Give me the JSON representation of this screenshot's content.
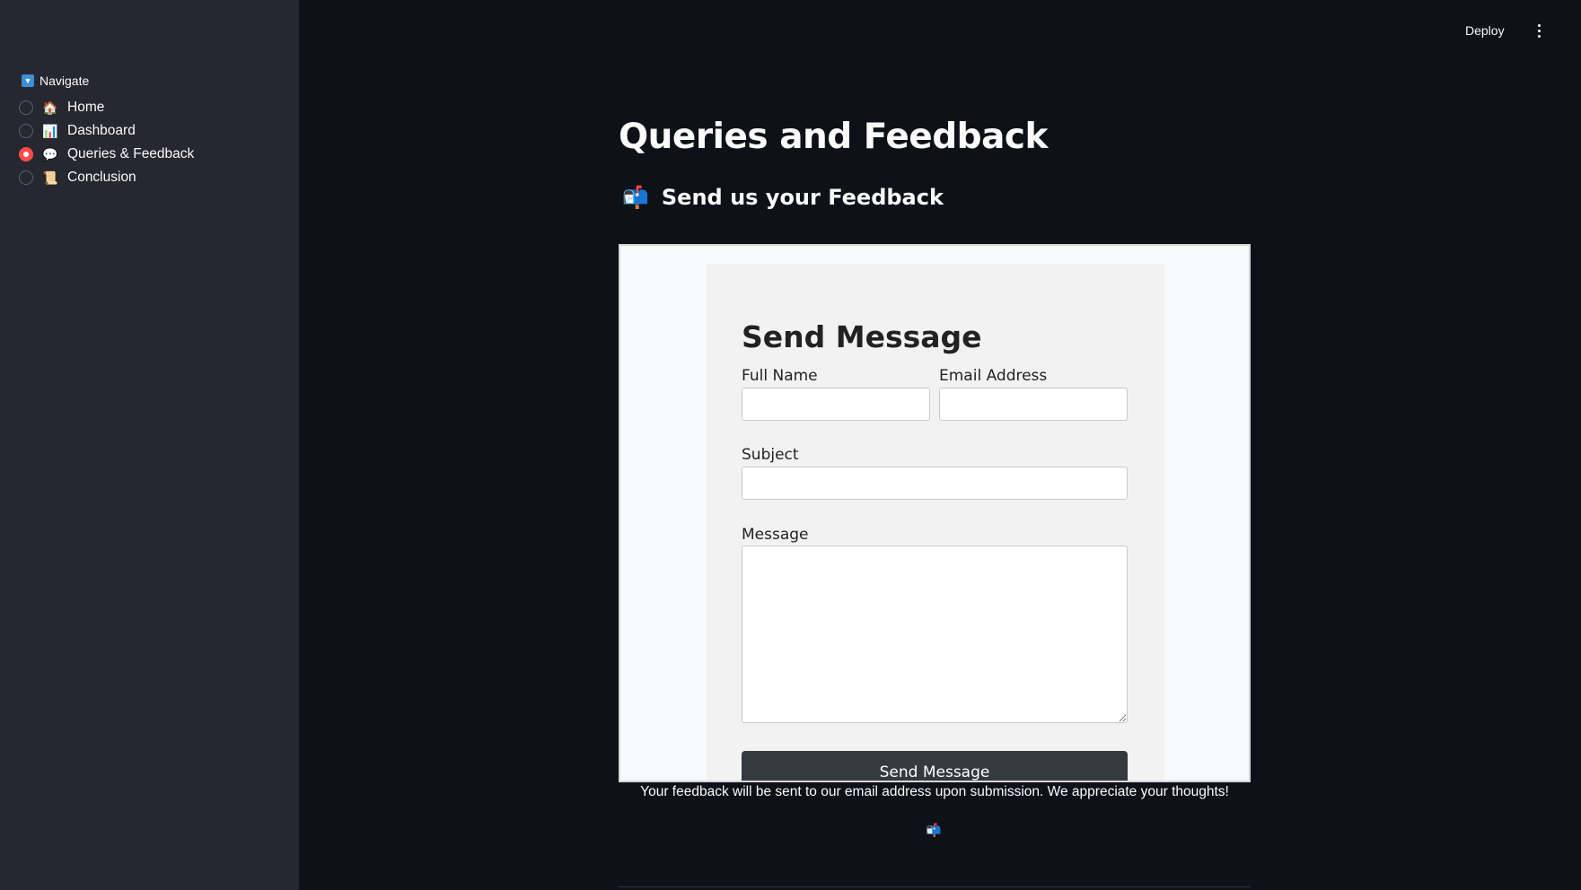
{
  "sidebar": {
    "nav_title": "Navigate",
    "nav_title_icon": "🔽",
    "items": [
      {
        "icon": "🏠",
        "label": "Home",
        "selected": false
      },
      {
        "icon": "📊",
        "label": "Dashboard",
        "selected": false
      },
      {
        "icon": "💬",
        "label": "Queries & Feedback",
        "selected": true
      },
      {
        "icon": "📜",
        "label": "Conclusion",
        "selected": false
      }
    ]
  },
  "header": {
    "deploy_label": "Deploy"
  },
  "main": {
    "title": "Queries and Feedback",
    "subheader_icon": "📬",
    "subheader": "Send us your Feedback",
    "form": {
      "title": "Send Message",
      "full_name_label": "Full Name",
      "email_label": "Email Address",
      "subject_label": "Subject",
      "message_label": "Message",
      "submit_label": "Send Message"
    },
    "note": "Your feedback will be sent to our email address upon submission. We appreciate your thoughts!",
    "footer_icon": "📬"
  },
  "colors": {
    "app_bg": "#0e1117",
    "sidebar_bg": "#262730",
    "accent": "#ff4b4b",
    "button_bg": "#343a40"
  }
}
